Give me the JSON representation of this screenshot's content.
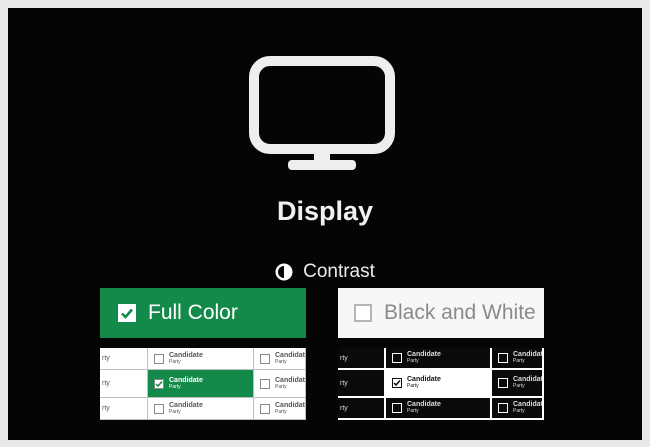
{
  "page": {
    "title": "Display",
    "icon": "monitor-icon"
  },
  "contrast": {
    "label": "Contrast",
    "icon": "contrast-icon"
  },
  "options": {
    "full_color": {
      "label": "Full Color",
      "checked": true,
      "color": "#148a4a"
    },
    "black_white": {
      "label": "Black and White",
      "checked": false
    }
  },
  "preview": {
    "row_label": "rty",
    "candidate": "Candidate",
    "party": "Party"
  }
}
